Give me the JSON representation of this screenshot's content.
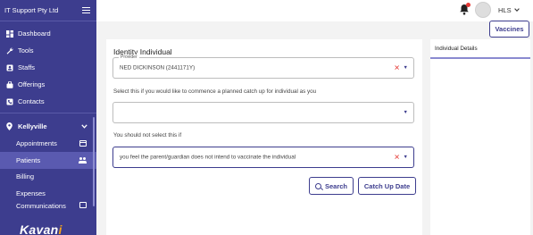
{
  "sidebar": {
    "company": "IT Support Pty Ltd",
    "nav": [
      {
        "label": "Dashboard",
        "icon": "dashboard-icon"
      },
      {
        "label": "Tools",
        "icon": "wrench-icon"
      },
      {
        "label": "Staffs",
        "icon": "staff-icon"
      },
      {
        "label": "Offerings",
        "icon": "bag-icon"
      },
      {
        "label": "Contacts",
        "icon": "phone-icon"
      }
    ],
    "location": "Kellyville",
    "sub_items": [
      {
        "label": "Appointments",
        "icon": "calendar-icon"
      },
      {
        "label": "Patients",
        "icon": "people-icon",
        "active": true
      },
      {
        "label": "Billing",
        "icon": "card-icon"
      },
      {
        "label": "Expenses",
        "icon": "card-icon"
      },
      {
        "label": "Communications",
        "icon": "message-icon"
      }
    ],
    "logo": {
      "text": "Kavan",
      "accent": "i"
    }
  },
  "topbar": {
    "user": "HLS"
  },
  "header": {
    "vaccines_label": "Vaccines"
  },
  "form": {
    "title": "Identity Individual",
    "provider_legend": "Provider",
    "provider_value": "NED DICKINSON (2441171Y)",
    "catchup_prompt": "Select this if you would like to commence a planned catch up for individual as you",
    "catchup_value": "",
    "reason_prompt": "You should not select this if",
    "reason_value": "you feel the parent/guardian does not intend to vaccinate the individual",
    "search_label": "Search",
    "catchup_date_label": "Catch Up Date"
  },
  "right_panel": {
    "tab_label": "Individual Details"
  },
  "colors": {
    "sidebar": "#3d3d8e",
    "accent": "#3d3d8e",
    "clear": "#e53935",
    "logo_accent": "#f2a31d"
  }
}
